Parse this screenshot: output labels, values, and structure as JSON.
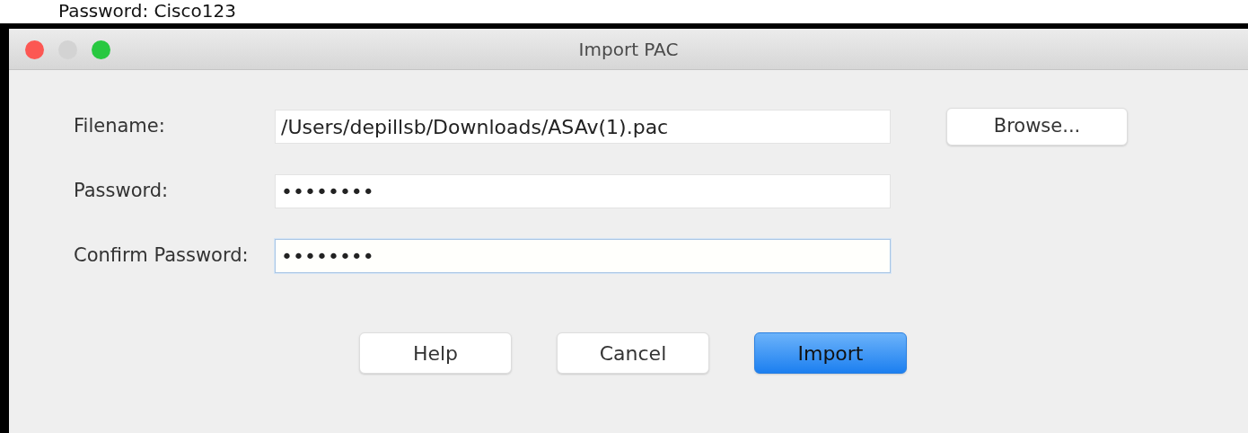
{
  "caption": "Password: Cisco123",
  "window": {
    "title": "Import PAC"
  },
  "fields": [
    {
      "label": "Filename:",
      "value": "/Users/depillsb/Downloads/ASAv(1).pac",
      "focused": false,
      "browse": "Browse..."
    },
    {
      "label": "Password:",
      "value": "••••••••",
      "focused": false
    },
    {
      "label": "Confirm Password:",
      "value": "••••••••",
      "focused": true
    }
  ],
  "buttons": [
    {
      "label": "Help",
      "default": false
    },
    {
      "label": "Cancel",
      "default": false
    },
    {
      "label": "Import",
      "default": true
    }
  ]
}
